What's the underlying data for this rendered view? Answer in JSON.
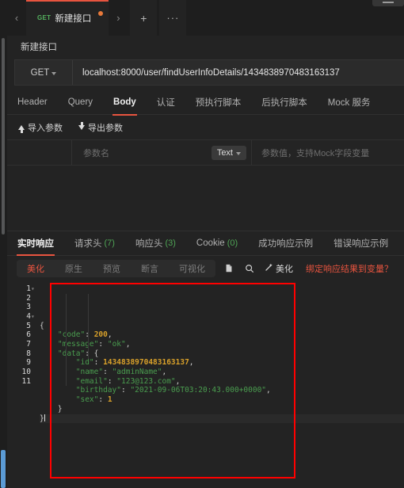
{
  "window": {
    "nub_icon": "window-menu-icon"
  },
  "tabstrip": {
    "prev_arrow": "‹",
    "next_arrow": "›",
    "add_label": "+",
    "more_label": "···",
    "tabs": [
      {
        "method": "GET",
        "title": "新建接口",
        "unsaved": true,
        "active": true
      }
    ]
  },
  "breadcrumb": {
    "text": "新建接口"
  },
  "url_row": {
    "method": "GET",
    "url": "localhost:8000/user/findUserInfoDetails/1434838970483163137"
  },
  "request_tabs": [
    {
      "label": "Header",
      "active": false
    },
    {
      "label": "Query",
      "active": false
    },
    {
      "label": "Body",
      "active": true
    },
    {
      "label": "认证",
      "active": false
    },
    {
      "label": "预执行脚本",
      "active": false
    },
    {
      "label": "后执行脚本",
      "active": false
    },
    {
      "label": "Mock 服务",
      "active": false
    }
  ],
  "param_actions": {
    "import_label": "导入参数",
    "export_label": "导出参数",
    "import_icon": "arrow-up-icon",
    "export_icon": "arrow-down-icon"
  },
  "param_table": {
    "name_placeholder": "参数名",
    "type_value": "Text",
    "value_placeholder": "参数值，支持Mock字段变量"
  },
  "response_tabs": [
    {
      "label": "实时响应",
      "count": "",
      "active": true
    },
    {
      "label": "请求头",
      "count": "(7)",
      "active": false
    },
    {
      "label": "响应头",
      "count": "(3)",
      "active": false
    },
    {
      "label": "Cookie",
      "count": "(0)",
      "active": false
    },
    {
      "label": "成功响应示例",
      "count": "",
      "active": false
    },
    {
      "label": "错误响应示例",
      "count": "",
      "active": false
    }
  ],
  "response_toolbar": {
    "segments": [
      {
        "label": "美化",
        "active": true
      },
      {
        "label": "原生",
        "active": false
      },
      {
        "label": "预览",
        "active": false
      },
      {
        "label": "断言",
        "active": false
      },
      {
        "label": "可视化",
        "active": false
      }
    ],
    "copy_icon": "copy-icon",
    "search_icon": "search-icon",
    "wand_icon": "magic-wand-icon",
    "beautify_label": "美化",
    "bind_link": "绑定响应结果到变量？"
  },
  "response_body": {
    "line_numbers": [
      "1",
      "2",
      "3",
      "4",
      "5",
      "6",
      "7",
      "8",
      "9",
      "10",
      "11"
    ],
    "json": {
      "code": 200,
      "message": "ok",
      "data": {
        "id": 1434838970483163137,
        "name": "adminName",
        "email": "123@123.com",
        "birthday": "2021-09-06T03:20:43.000+0000",
        "sex": 1
      }
    },
    "lines": [
      "{",
      "    \"code\": 200,",
      "    \"message\": \"ok\",",
      "    \"data\": {",
      "        \"id\": 1434838970483163137,",
      "        \"name\": \"adminName\",",
      "        \"email\": \"123@123.com\",",
      "        \"birthday\": \"2021-09-06T03:20:43.000+0000\",",
      "        \"sex\": 1",
      "    }",
      "}"
    ]
  },
  "colors": {
    "accent_red": "#e8543f",
    "annotation_red": "#ff0000",
    "method_green": "#54b15e",
    "json_string_green": "#4a9d4f",
    "json_number_gold": "#d8a02a",
    "unsaved_dot": "#e8793a",
    "scrollbar_blue": "#5b9bd5",
    "background": "#232323"
  }
}
